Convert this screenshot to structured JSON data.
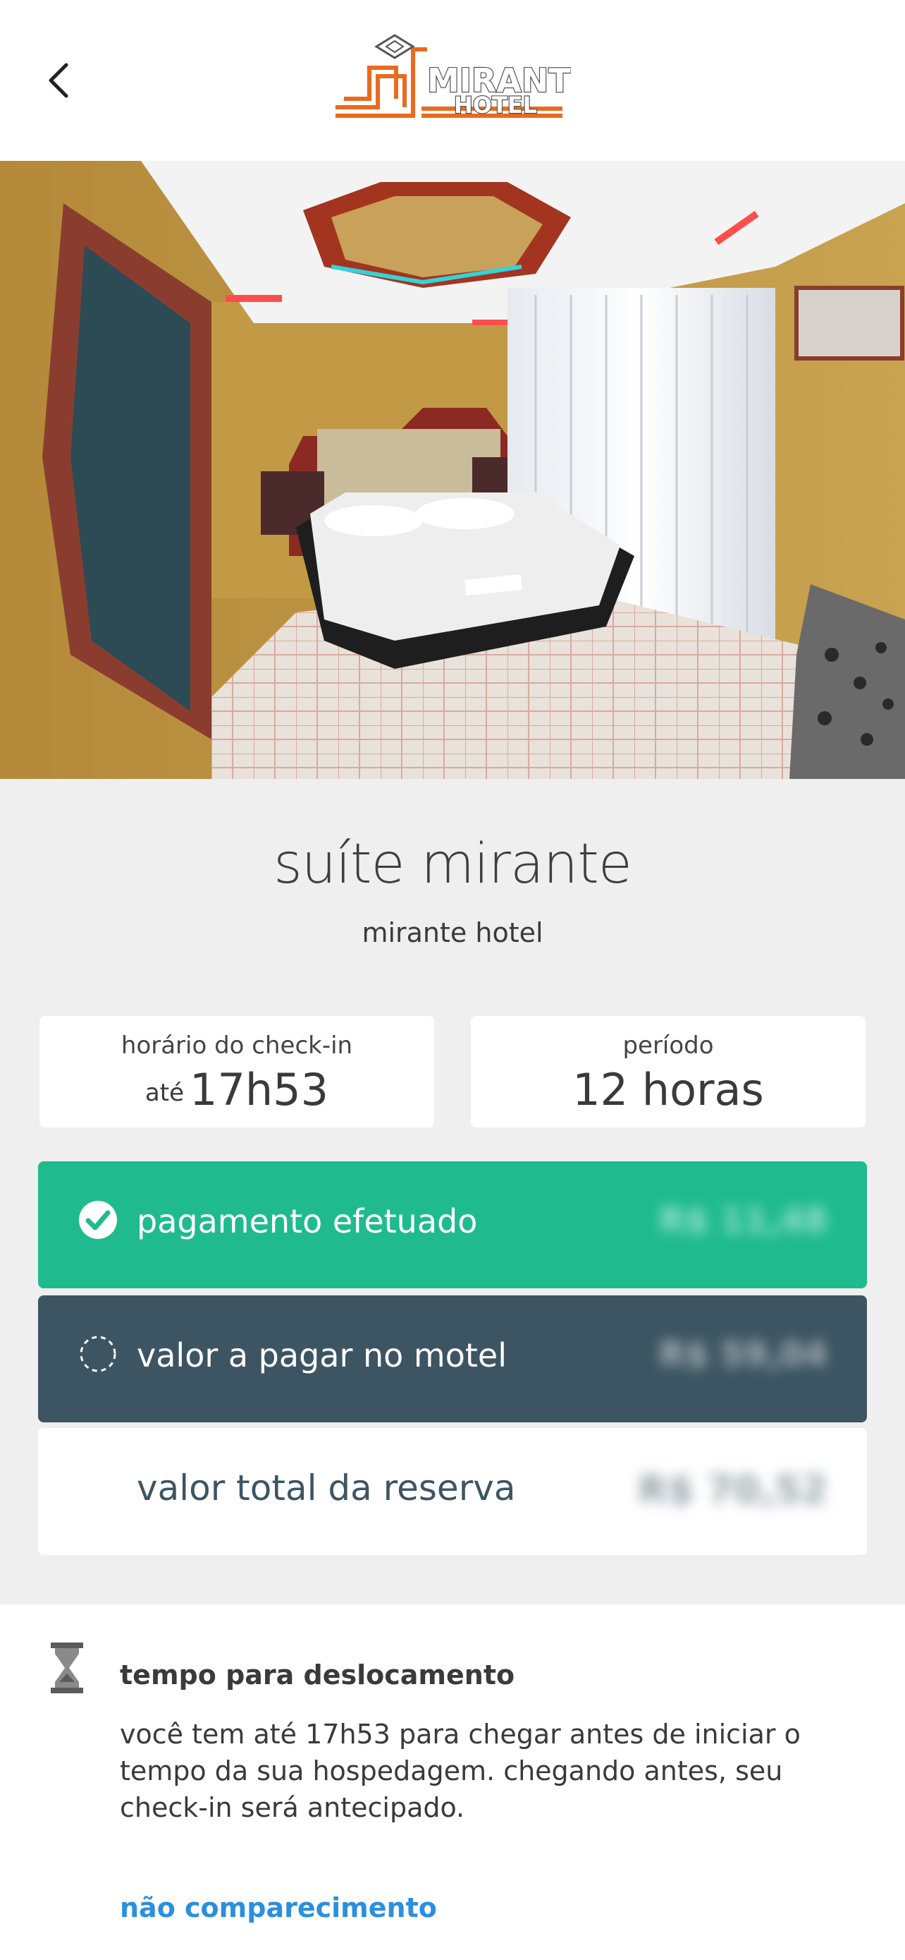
{
  "header": {
    "back_icon": "chevron-left-icon",
    "logo_line1": "MIRANTE",
    "logo_line2": "HOTEL"
  },
  "photo": {
    "alt": "suíte mirante"
  },
  "room": {
    "title": "suíte mirante",
    "hotel": "mirante hotel"
  },
  "checkin": {
    "label": "horário do check-in",
    "prefix": "até",
    "value": "17h53"
  },
  "period": {
    "label": "período",
    "value": "12 horas"
  },
  "payment": {
    "paid_label": "pagamento efetuado",
    "paid_icon": "check-circle-icon",
    "due_label": "valor a pagar no motel",
    "due_icon": "dashed-circle-icon",
    "total_label": "valor total da reserva",
    "total_amount": "R$ 70,52",
    "colors": {
      "paid": "#1fbb8e",
      "due": "#3d5562",
      "total_text": "#3d5562"
    }
  },
  "travel": {
    "icon": "hourglass-icon",
    "title": "tempo para deslocamento",
    "text": "você tem até 17h53 para chegar antes de iniciar o tempo da sua hospedagem. chegando antes, seu check-in será antecipado.",
    "noshow_link": "não comparecimento",
    "link_color": "#2b8fe0"
  },
  "colors": {
    "brand_orange": "#ea6a1f",
    "background_grey": "#efefef"
  }
}
